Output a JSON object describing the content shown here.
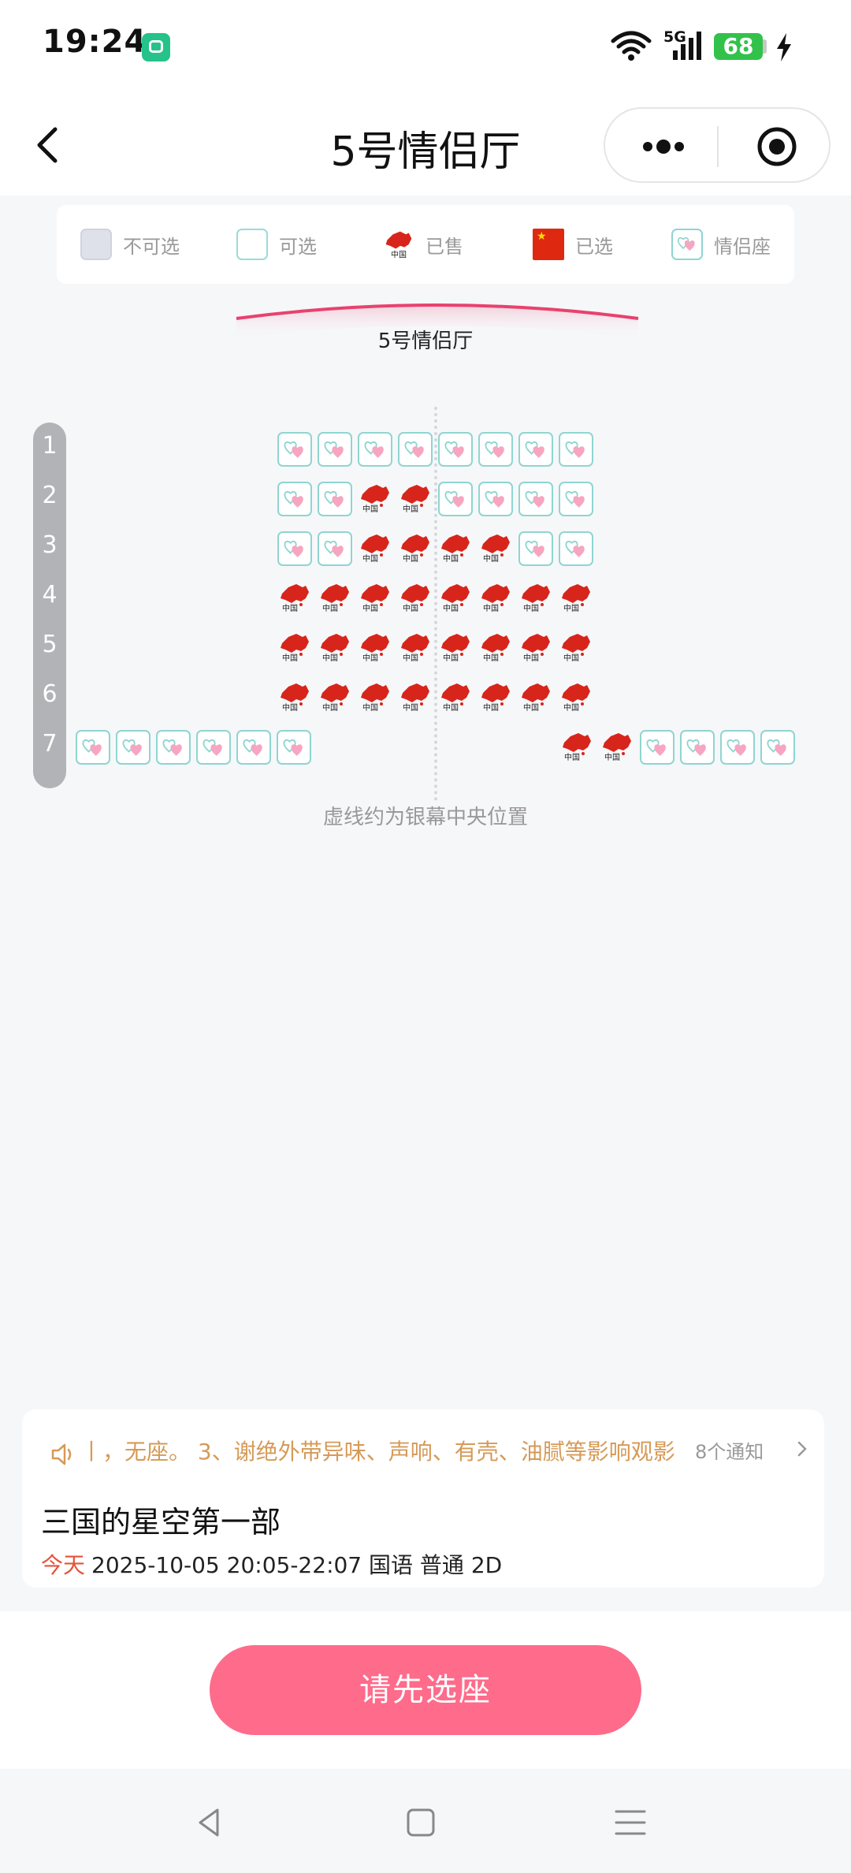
{
  "status_bar": {
    "time": "19:24",
    "network": "5G",
    "battery": "68"
  },
  "nav": {
    "title": "5号情侣厅"
  },
  "legend": [
    {
      "type": "disabled",
      "label": "不可选"
    },
    {
      "type": "available",
      "label": "可选"
    },
    {
      "type": "sold",
      "label": "已售"
    },
    {
      "type": "selected",
      "label": "已选"
    },
    {
      "type": "couple",
      "label": "情侣座"
    }
  ],
  "screen": {
    "name": "5号情侣厅"
  },
  "seat_map": {
    "row_labels": [
      "1",
      "2",
      "3",
      "4",
      "5",
      "6",
      "7"
    ],
    "rows": [
      [
        "couple",
        "couple",
        "couple",
        "couple",
        "couple",
        "couple",
        "couple",
        "couple"
      ],
      [
        "couple",
        "couple",
        "sold",
        "sold",
        "couple",
        "couple",
        "couple",
        "couple"
      ],
      [
        "couple",
        "couple",
        "sold",
        "sold",
        "sold",
        "sold",
        "couple",
        "couple"
      ],
      [
        "sold",
        "sold",
        "sold",
        "sold",
        "sold",
        "sold",
        "sold",
        "sold"
      ],
      [
        "sold",
        "sold",
        "sold",
        "sold",
        "sold",
        "sold",
        "sold",
        "sold"
      ],
      [
        "sold",
        "sold",
        "sold",
        "sold",
        "sold",
        "sold",
        "sold",
        "sold"
      ]
    ],
    "row7_left": [
      "couple",
      "couple",
      "couple",
      "couple",
      "couple",
      "couple"
    ],
    "row7_right": [
      "sold",
      "sold",
      "couple",
      "couple",
      "couple",
      "couple"
    ],
    "hint": "虚线约为银幕中央位置"
  },
  "info": {
    "notice": "丨，无座。 3、谢绝外带异味、声响、有壳、油腻等影响观影",
    "notice_count": "8个通知",
    "movie_title": "三国的星空第一部",
    "day": "今天",
    "showtime": "2025-10-05 20:05-22:07 国语 普通 2D"
  },
  "cta": {
    "label": "请先选座"
  },
  "colors": {
    "cta": "#fe6b8b",
    "couple_border": "#8fd5d1",
    "notice": "#d69a57",
    "today": "#e5533a",
    "sold_red": "#d8251b"
  }
}
